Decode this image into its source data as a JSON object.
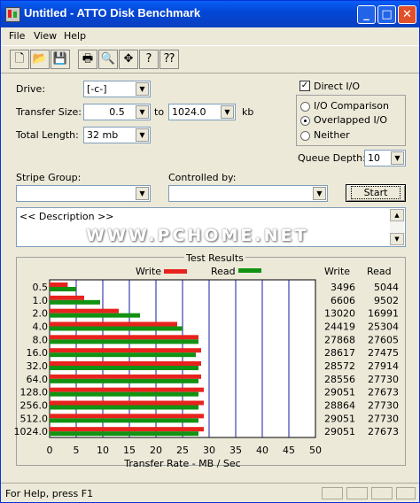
{
  "window": {
    "title": "Untitled - ATTO Disk Benchmark",
    "min": "_",
    "max": "□",
    "close": "✕"
  },
  "menu": [
    "File",
    "View",
    "Help"
  ],
  "toolbar": [
    "new-icon",
    "open-icon",
    "save-icon",
    "print-icon",
    "print-preview-icon",
    "move-icon",
    "help-icon",
    "context-help-icon"
  ],
  "form": {
    "drive_label": "Drive:",
    "drive_value": "[-c-]",
    "transfer_label": "Transfer Size:",
    "transfer_from": "0.5",
    "to_label": "to",
    "transfer_to": "1024.0",
    "kb_label": "kb",
    "length_label": "Total Length:",
    "length_value": "32 mb",
    "direct_io_label": "Direct I/O",
    "io_comparison_label": "I/O Comparison",
    "overlapped_label": "Overlapped I/O",
    "neither_label": "Neither",
    "queue_label": "Queue Depth:",
    "queue_value": "10",
    "stripe_label": "Stripe Group:",
    "controlled_label": "Controlled by:",
    "start_label": "Start",
    "description": "<< Description >>",
    "watermark": "WWW.PCHOME.NET"
  },
  "results": {
    "title": "Test Results",
    "write_label": "Write",
    "read_label": "Read",
    "col_write": "Write",
    "col_read": "Read",
    "write_color": "#e8231e",
    "read_color": "#129212"
  },
  "chart_data": {
    "type": "bar",
    "categories": [
      "0.5",
      "1.0",
      "2.0",
      "4.0",
      "8.0",
      "16.0",
      "32.0",
      "64.0",
      "128.0",
      "256.0",
      "512.0",
      "1024.0"
    ],
    "series": [
      {
        "name": "Write",
        "values": [
          3496,
          6606,
          13020,
          24419,
          27868,
          28617,
          28572,
          28556,
          29051,
          28864,
          29051,
          29051
        ]
      },
      {
        "name": "Read",
        "values": [
          5044,
          9502,
          16991,
          25304,
          27605,
          27475,
          27914,
          27730,
          27673,
          27730,
          27730,
          27673
        ]
      }
    ],
    "bar_lengths_mb": {
      "write": [
        3.4,
        6.5,
        13.0,
        24.0,
        28.0,
        28.5,
        28.5,
        28.5,
        29.0,
        29.0,
        29.0,
        29.0
      ],
      "read": [
        5.0,
        9.5,
        17.0,
        25.0,
        28.0,
        27.5,
        28.0,
        28.0,
        28.0,
        28.0,
        28.0,
        28.0
      ]
    },
    "xticks": [
      "0",
      "5",
      "10",
      "15",
      "20",
      "25",
      "30",
      "35",
      "40",
      "45",
      "50"
    ],
    "xlim": [
      0,
      50
    ],
    "xlabel": "Transfer Rate - MB / Sec",
    "legend": "top-center",
    "grid": true
  },
  "status": {
    "text": "For Help, press F1"
  }
}
